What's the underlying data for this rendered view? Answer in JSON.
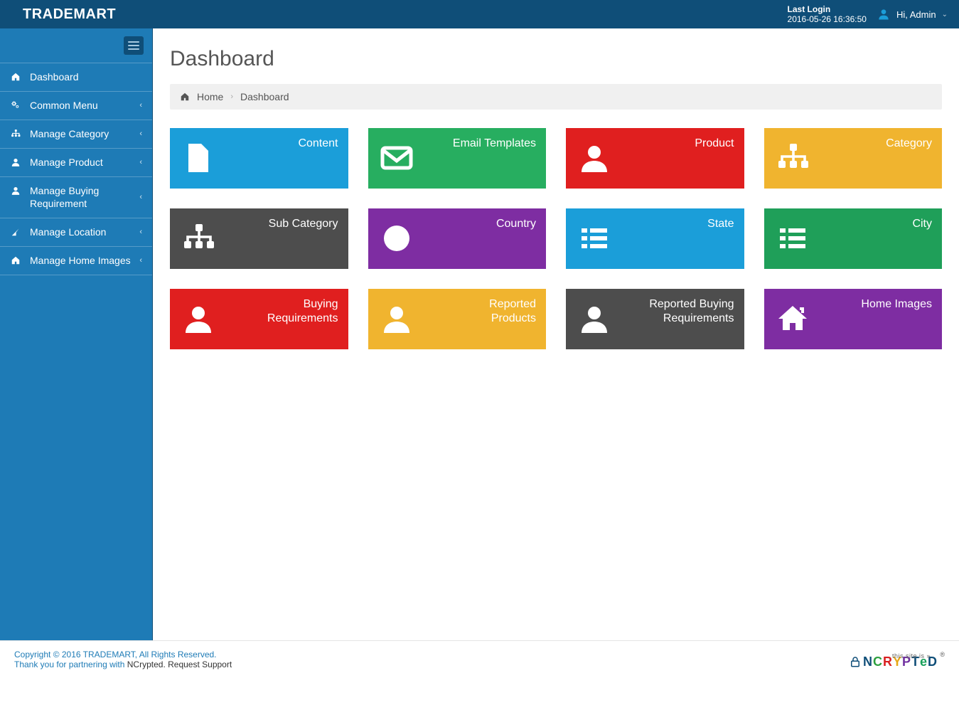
{
  "header": {
    "brand": "TRADEMART",
    "last_login_label": "Last Login",
    "last_login_value": "2016-05-26 16:36:50",
    "greeting": "Hi, Admin"
  },
  "sidebar": {
    "items": [
      {
        "label": "Dashboard",
        "icon": "home",
        "expandable": false
      },
      {
        "label": "Common Menu",
        "icon": "cogs",
        "expandable": true
      },
      {
        "label": "Manage Category",
        "icon": "sitemap",
        "expandable": true
      },
      {
        "label": "Manage Product",
        "icon": "user",
        "expandable": true
      },
      {
        "label": "Manage Buying Requirement",
        "icon": "user",
        "expandable": true
      },
      {
        "label": "Manage Location",
        "icon": "location",
        "expandable": true
      },
      {
        "label": "Manage Home Images",
        "icon": "home",
        "expandable": true
      }
    ]
  },
  "page": {
    "title": "Dashboard",
    "crumb_home": "Home",
    "crumb_current": "Dashboard"
  },
  "tiles": [
    {
      "label": "Content",
      "icon": "file",
      "color": "c-blue"
    },
    {
      "label": "Email Templates",
      "icon": "envelope",
      "color": "c-green"
    },
    {
      "label": "Product",
      "icon": "user",
      "color": "c-red"
    },
    {
      "label": "Category",
      "icon": "sitemap",
      "color": "c-orange"
    },
    {
      "label": "Sub Category",
      "icon": "sitemap",
      "color": "c-dark"
    },
    {
      "label": "Country",
      "icon": "globe",
      "color": "c-purple"
    },
    {
      "label": "State",
      "icon": "list",
      "color": "c-blue"
    },
    {
      "label": "City",
      "icon": "list",
      "color": "c-green2"
    },
    {
      "label": "Buying Requirements",
      "icon": "user",
      "color": "c-red"
    },
    {
      "label": "Reported Products",
      "icon": "user",
      "color": "c-orange"
    },
    {
      "label": "Reported Buying Requirements",
      "icon": "user",
      "color": "c-dark"
    },
    {
      "label": "Home Images",
      "icon": "home",
      "color": "c-purple"
    }
  ],
  "footer": {
    "copyright": "Copyright © 2016 TRADEMART, All Rights Reserved.",
    "thanks_prefix": "Thank you for partnering with ",
    "partner": "NCrypted",
    "period": ". ",
    "support": "Request Support",
    "badge_tag": "this site is »",
    "badge_reg": "®"
  }
}
